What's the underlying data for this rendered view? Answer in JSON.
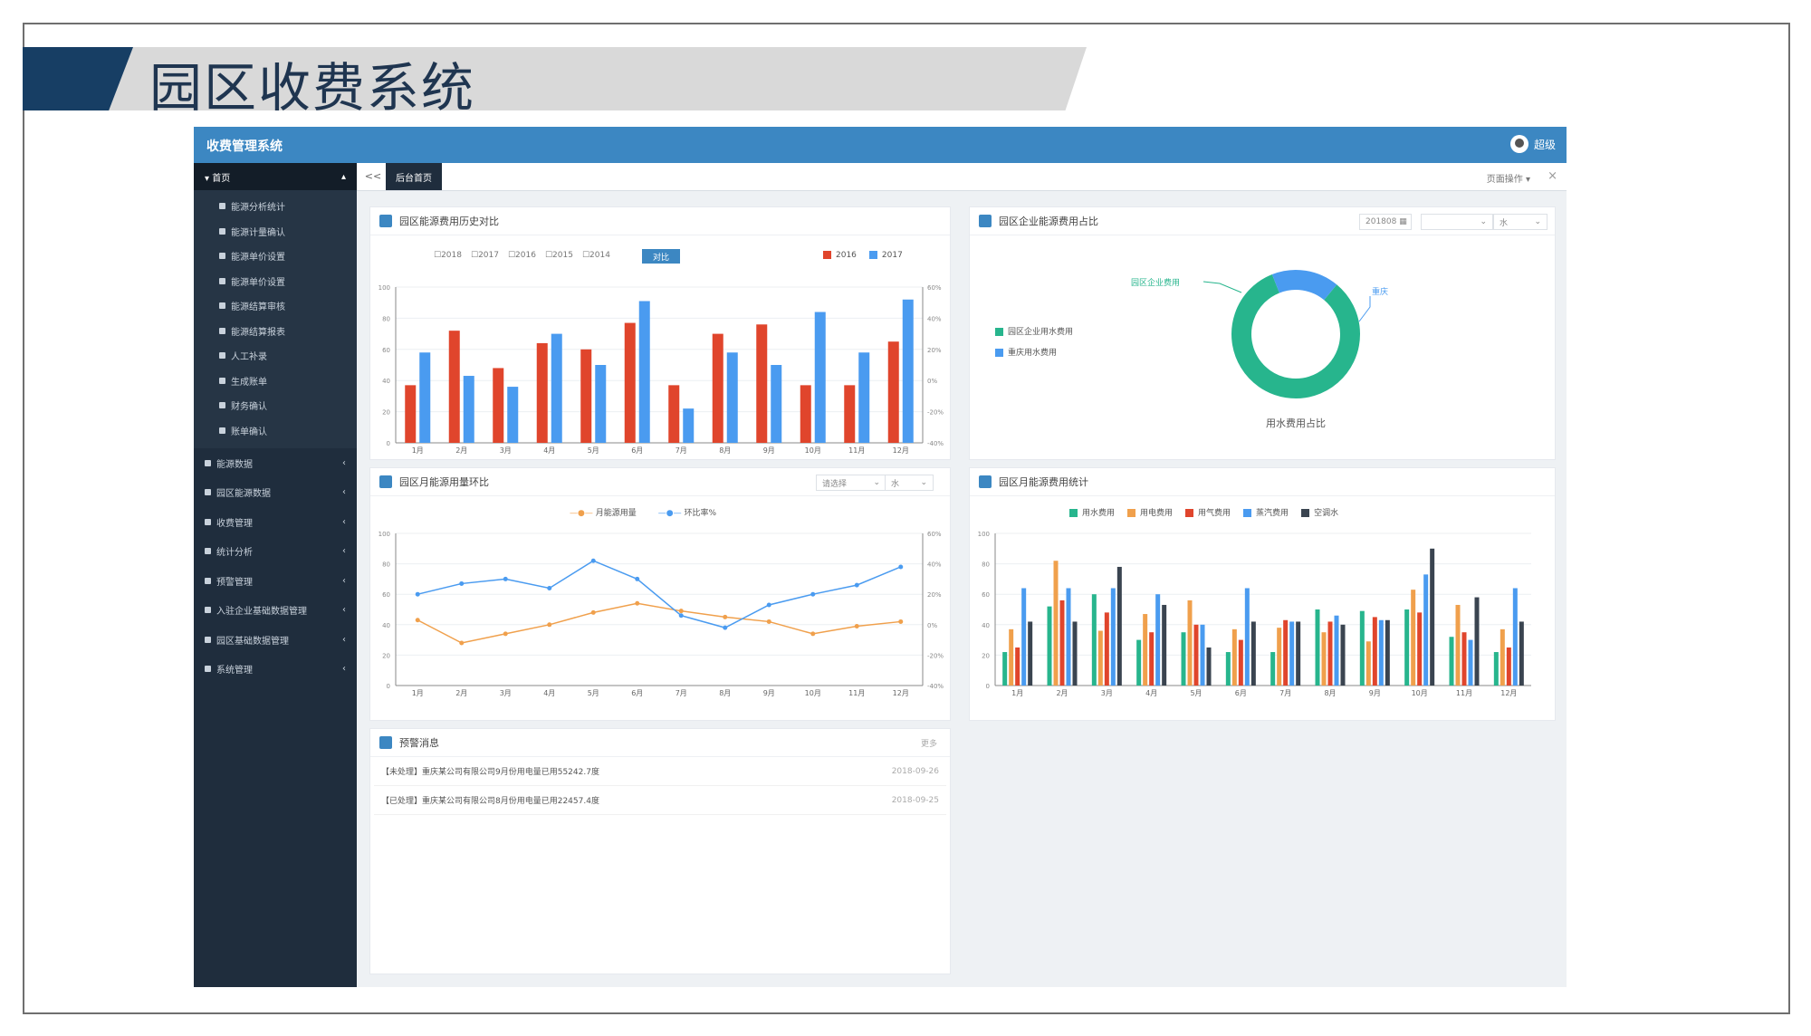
{
  "banner": {
    "title": "园区收费系统"
  },
  "header": {
    "brand": "收费管理系统",
    "user": "超级"
  },
  "sidebar": {
    "head": "首页",
    "sub_items": [
      "能源分析统计",
      "能源计量确认",
      "能源单价设置",
      "能源单价设置",
      "能源结算审核",
      "能源结算报表",
      "人工补录",
      "生成账单",
      "财务确认",
      "账单确认"
    ],
    "main_items": [
      "能源数据",
      "园区能源数据",
      "收费管理",
      "统计分析",
      "预警管理",
      "入驻企业基础数据管理",
      "园区基础数据管理",
      "系统管理"
    ]
  },
  "tabs": {
    "back": "<<",
    "active": "后台首页",
    "ops": "页面操作 ▾",
    "close": "×"
  },
  "panels": {
    "history": {
      "title": "园区能源费用历史对比",
      "years": [
        "2018",
        "2017",
        "2016",
        "2015",
        "2014"
      ],
      "query": "对比",
      "legend": [
        "2016",
        "2017"
      ]
    },
    "ratio": {
      "title": "园区企业能源费用占比",
      "date": "201808",
      "select1": "",
      "select2": "水",
      "legend": [
        "园区企业用水费用",
        "重庆用水费用"
      ],
      "label_left": "园区企业费用",
      "label_right": "重庆",
      "caption": "用水费用占比"
    },
    "monthly": {
      "title": "园区月能源用量环比",
      "select1": "请选择",
      "select2": "水",
      "legend": [
        "月能源用量",
        "环比率%"
      ]
    },
    "stats": {
      "title": "园区月能源费用统计",
      "legend": [
        "用水费用",
        "用电费用",
        "用气费用",
        "蒸汽费用",
        "空调水"
      ]
    },
    "alerts": {
      "title": "预警消息",
      "more": "更多",
      "items": [
        {
          "text": "【未处理】重庆某公司有限公司9月份用电量已用55242.7度",
          "date": "2018-09-26"
        },
        {
          "text": "【已处理】重庆某公司有限公司8月份用电量已用22457.4度",
          "date": "2018-09-25"
        }
      ]
    }
  },
  "colors": {
    "red": "#e0452c",
    "blue": "#4a9bf0",
    "teal": "#27b58d",
    "orange": "#f0a04c",
    "dark": "#3a4450",
    "topbar": "#3c87c2",
    "sidebar": "#1f2d3d"
  },
  "chart_data": [
    {
      "type": "bar",
      "categories": [
        "1月",
        "2月",
        "3月",
        "4月",
        "5月",
        "6月",
        "7月",
        "8月",
        "9月",
        "10月",
        "11月",
        "12月"
      ],
      "series": [
        {
          "name": "2016",
          "values": [
            37,
            72,
            48,
            64,
            60,
            77,
            37,
            70,
            76,
            37,
            37,
            65
          ]
        },
        {
          "name": "2017",
          "values": [
            58,
            43,
            36,
            70,
            50,
            91,
            22,
            58,
            50,
            84,
            58,
            92
          ]
        }
      ],
      "ylim": [
        0,
        100
      ],
      "yticks": [
        "0",
        "20",
        "40",
        "60",
        "80",
        "100"
      ],
      "y2ticks": [
        "-40%",
        "-20%",
        "0%",
        "20%",
        "40%",
        "60%"
      ]
    },
    {
      "type": "pie",
      "labels": [
        "园区企业费用",
        "重庆"
      ],
      "values": [
        83,
        17
      ]
    },
    {
      "type": "line",
      "categories": [
        "1月",
        "2月",
        "3月",
        "4月",
        "5月",
        "6月",
        "7月",
        "8月",
        "9月",
        "10月",
        "11月",
        "12月"
      ],
      "series": [
        {
          "name": "月能源用量",
          "values": [
            43,
            28,
            34,
            40,
            48,
            54,
            49,
            45,
            42,
            34,
            39,
            42
          ]
        },
        {
          "name": "环比率%",
          "values": [
            60,
            67,
            70,
            64,
            82,
            70,
            46,
            38,
            53,
            60,
            66,
            78
          ]
        }
      ],
      "ylim": [
        0,
        100
      ],
      "yticks": [
        "0",
        "20",
        "40",
        "60",
        "80",
        "100"
      ],
      "y2ticks": [
        "-40%",
        "-20%",
        "0%",
        "20%",
        "40%",
        "60%"
      ]
    },
    {
      "type": "bar",
      "categories": [
        "1月",
        "2月",
        "3月",
        "4月",
        "5月",
        "6月",
        "7月",
        "8月",
        "9月",
        "10月",
        "11月",
        "12月"
      ],
      "series": [
        {
          "name": "用水费用",
          "values": [
            22,
            52,
            60,
            30,
            35,
            22,
            22,
            50,
            49,
            50,
            32,
            22
          ]
        },
        {
          "name": "用电费用",
          "values": [
            37,
            82,
            36,
            47,
            56,
            37,
            38,
            35,
            29,
            63,
            53,
            37
          ]
        },
        {
          "name": "用气费用",
          "values": [
            25,
            56,
            48,
            35,
            40,
            30,
            43,
            42,
            45,
            48,
            35,
            25
          ]
        },
        {
          "name": "蒸汽费用",
          "values": [
            64,
            64,
            64,
            60,
            40,
            64,
            42,
            46,
            43,
            73,
            30,
            64
          ]
        },
        {
          "name": "空调水",
          "values": [
            42,
            42,
            78,
            53,
            25,
            42,
            42,
            40,
            43,
            90,
            58,
            42
          ]
        }
      ],
      "ylim": [
        0,
        100
      ],
      "yticks": [
        "0",
        "20",
        "40",
        "60",
        "80",
        "100"
      ]
    }
  ]
}
